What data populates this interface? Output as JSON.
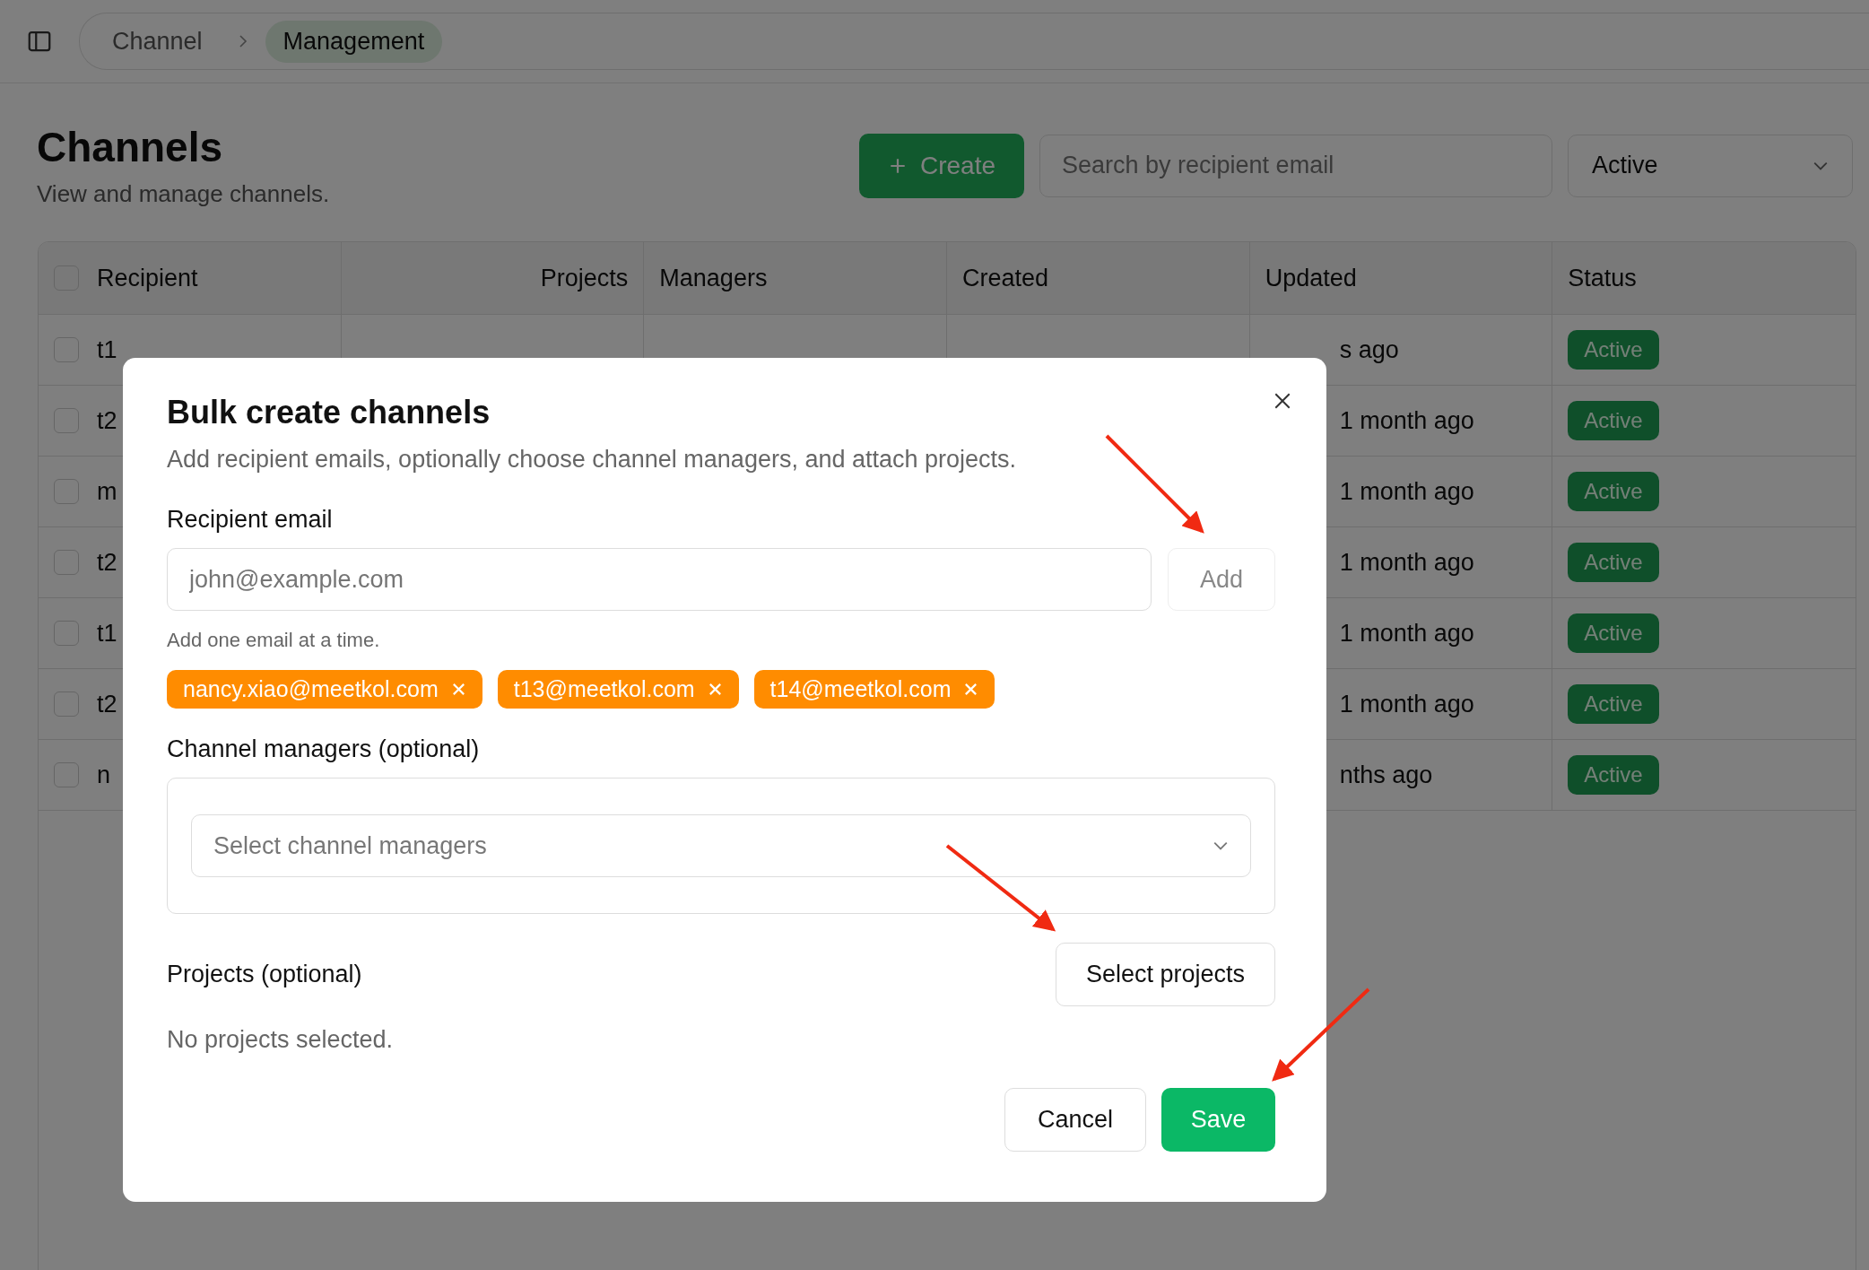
{
  "header": {
    "breadcrumbs": [
      {
        "label": "Channel",
        "selected": false
      },
      {
        "label": "Management",
        "selected": true
      }
    ]
  },
  "page": {
    "title": "Channels",
    "subtitle": "View and manage channels.",
    "create_button": "Create",
    "search": {
      "placeholder": "Search by recipient email"
    },
    "status_filter": {
      "value": "Active"
    }
  },
  "table": {
    "select_all_checked": false,
    "columns": [
      "Recipient",
      "Projects",
      "Managers",
      "Created",
      "Updated",
      "Status"
    ],
    "rows": [
      {
        "recipient": "t1",
        "updated": "s ago",
        "status": "Active",
        "checked": false
      },
      {
        "recipient": "t2",
        "updated": "1 month ago",
        "status": "Active",
        "checked": false
      },
      {
        "recipient": "m",
        "updated": "1 month ago",
        "status": "Active",
        "checked": false
      },
      {
        "recipient": "t2",
        "updated": "1 month ago",
        "status": "Active",
        "checked": false
      },
      {
        "recipient": "t1",
        "updated": "1 month ago",
        "status": "Active",
        "checked": false
      },
      {
        "recipient": "t2",
        "updated": "1 month ago",
        "status": "Active",
        "checked": false
      },
      {
        "recipient": "n",
        "updated": "nths ago",
        "status": "Active",
        "checked": false
      }
    ]
  },
  "dialog": {
    "title": "Bulk create channels",
    "description": "Add recipient emails, optionally choose channel managers, and attach projects.",
    "email": {
      "label": "Recipient email",
      "placeholder": "john@example.com",
      "hint": "Add one email at a time.",
      "add_button": {
        "label": "Add",
        "disabled": true
      }
    },
    "tags": [
      {
        "label": "nancy.xiao@meetkol.com"
      },
      {
        "label": "t13@meetkol.com"
      },
      {
        "label": "t14@meetkol.com"
      }
    ],
    "managers": {
      "label": "Channel managers (optional)",
      "placeholder": "Select channel managers"
    },
    "projects": {
      "label": "Projects (optional)",
      "button": "Select projects",
      "empty_text": "No projects selected."
    },
    "buttons": {
      "cancel": "Cancel",
      "save": "Save"
    }
  }
}
